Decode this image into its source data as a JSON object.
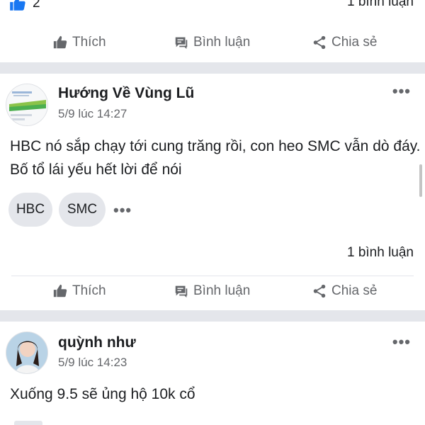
{
  "top": {
    "like_count": "2",
    "comments": "1 bình luận"
  },
  "actions": {
    "like": "Thích",
    "comment": "Bình luận",
    "share": "Chia sẻ"
  },
  "posts": [
    {
      "author": "Hướng Về Vùng Lũ",
      "timestamp": "5/9 lúc 14:27",
      "text": "HBC nó sắp chạy tới cung trăng rồi, con heo SMC vẫn dò đáy. Bố tổ lái yếu hết lời để nói",
      "tags": [
        "HBC",
        "SMC"
      ],
      "comments": "1 bình luận"
    },
    {
      "author": "quỳnh như",
      "timestamp": "5/9 lúc 14:23",
      "text": "Xuống 9.5 sẽ ủng hộ 10k cổ"
    }
  ],
  "colors": {
    "like_blue": "#1877f2",
    "secondary_text": "#65676b",
    "separator": "#e4e6eb"
  }
}
